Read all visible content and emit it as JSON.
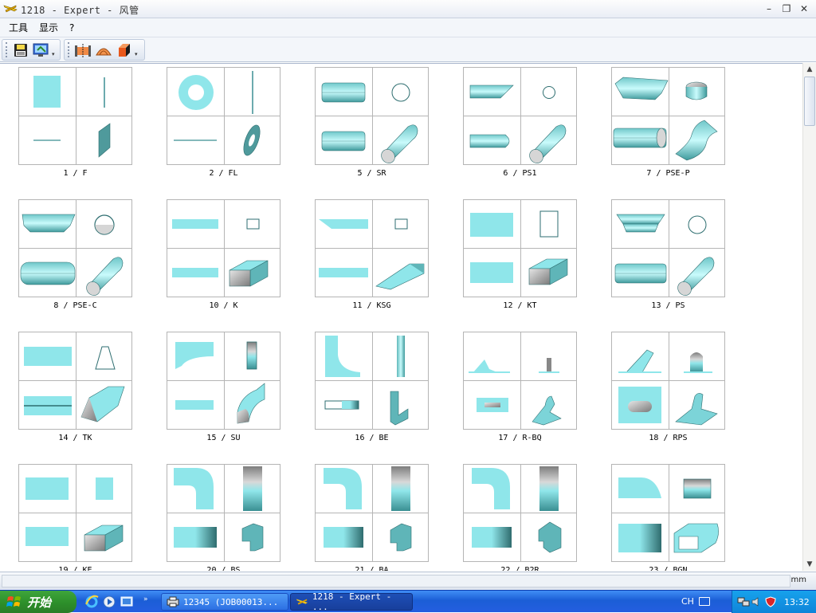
{
  "window": {
    "title": "1218 - Expert - 风管",
    "min_glyph": "–",
    "restore_glyph": "❐",
    "close_glyph": "✕"
  },
  "menu": [
    "工具",
    "显示",
    "?"
  ],
  "toolbar": {
    "group1": [
      "save-icon",
      "monitor-icon"
    ],
    "group2": [
      "duct-flange-icon",
      "duct-shell-icon",
      "box-3d-icon"
    ]
  },
  "grid": {
    "items": [
      {
        "label": "1 / F",
        "kind": "F"
      },
      {
        "label": "2 / FL",
        "kind": "FL"
      },
      {
        "label": "5 / SR",
        "kind": "SR"
      },
      {
        "label": "6 / PS1",
        "kind": "PS1"
      },
      {
        "label": "7 / PSE-P",
        "kind": "PSEP"
      },
      {
        "label": "8 / PSE-C",
        "kind": "PSEC"
      },
      {
        "label": "10 / K",
        "kind": "K"
      },
      {
        "label": "11 / KSG",
        "kind": "KSG"
      },
      {
        "label": "12 / KT",
        "kind": "KT"
      },
      {
        "label": "13 / PS",
        "kind": "PS"
      },
      {
        "label": "14 / TK",
        "kind": "TK"
      },
      {
        "label": "15 / SU",
        "kind": "SU"
      },
      {
        "label": "16 / BE",
        "kind": "BE"
      },
      {
        "label": "17 / R-BQ",
        "kind": "RBQ"
      },
      {
        "label": "18 / RPS",
        "kind": "RPS"
      },
      {
        "label": "19 / KE",
        "kind": "KE"
      },
      {
        "label": "20 / BS",
        "kind": "BS"
      },
      {
        "label": "21 / BA",
        "kind": "BA"
      },
      {
        "label": "22 / B2R",
        "kind": "B2R"
      },
      {
        "label": "23 / BGN",
        "kind": "BGN"
      }
    ]
  },
  "status": {
    "unit": "mm"
  },
  "taskbar": {
    "start_label": "开始",
    "items": [
      {
        "label": "12345 (JOB00013...",
        "active": false
      },
      {
        "label": "1218 - Expert - ...",
        "active": true
      }
    ],
    "ime": "CH",
    "clock": "13:32",
    "quicklaunch_chevron": "»"
  },
  "colors": {
    "duct": "#8fe6ea",
    "duct_dark": "#3a8f92",
    "outline": "#2e6e70"
  }
}
